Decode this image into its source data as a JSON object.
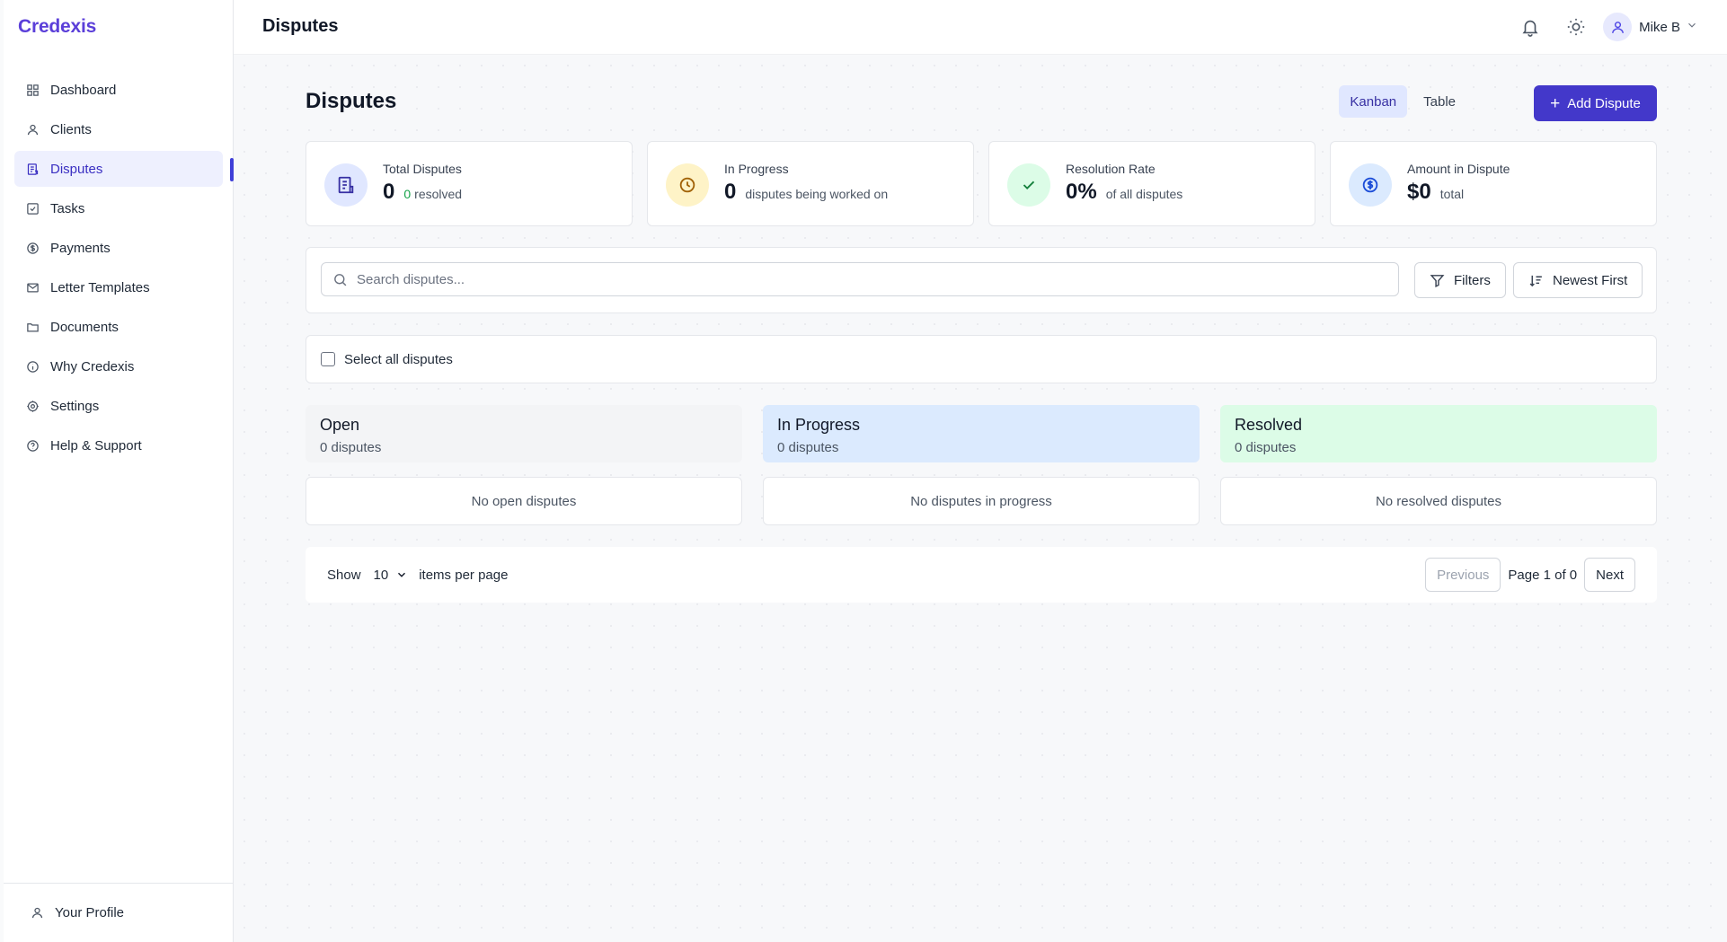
{
  "app": {
    "brand": "Credexis"
  },
  "header": {
    "title": "Disputes",
    "user_name": "Mike B"
  },
  "sidebar": {
    "items": [
      {
        "label": "Dashboard",
        "icon": "grid-icon"
      },
      {
        "label": "Clients",
        "icon": "user-icon"
      },
      {
        "label": "Disputes",
        "icon": "file-list-icon",
        "active": true
      },
      {
        "label": "Tasks",
        "icon": "checkbox-icon"
      },
      {
        "label": "Payments",
        "icon": "dollar-circle-icon"
      },
      {
        "label": "Letter Templates",
        "icon": "mail-icon"
      },
      {
        "label": "Documents",
        "icon": "folder-icon"
      },
      {
        "label": "Why Credexis",
        "icon": "info-icon"
      },
      {
        "label": "Settings",
        "icon": "gear-icon"
      },
      {
        "label": "Help & Support",
        "icon": "help-icon"
      }
    ],
    "profile_label": "Your Profile"
  },
  "page": {
    "title": "Disputes",
    "view_toggle": {
      "kanban": "Kanban",
      "table": "Table",
      "active": "Kanban"
    },
    "add_button": "Add Dispute"
  },
  "stats": [
    {
      "label": "Total Disputes",
      "value": "0",
      "sub_highlight": "0",
      "sub": "resolved",
      "icon": "document-icon",
      "color": "#e0e7ff"
    },
    {
      "label": "In Progress",
      "value": "0",
      "sub": "disputes being worked on",
      "icon": "clock-icon",
      "color": "#fef3c7"
    },
    {
      "label": "Resolution Rate",
      "value": "0%",
      "sub": "of all disputes",
      "icon": "check-icon",
      "color": "#dcfce7"
    },
    {
      "label": "Amount in Dispute",
      "value": "$0",
      "sub": "total",
      "icon": "dollar-circle-icon",
      "color": "#dbeafe"
    }
  ],
  "search": {
    "placeholder": "Search disputes...",
    "value": ""
  },
  "filters_label": "Filters",
  "sort_label": "Newest First",
  "select_all_label": "Select all disputes",
  "columns": [
    {
      "title": "Open",
      "count": "0 disputes",
      "empty": "No open disputes",
      "color": "#f3f4f6"
    },
    {
      "title": "In Progress",
      "count": "0 disputes",
      "empty": "No disputes in progress",
      "color": "#dbeafe"
    },
    {
      "title": "Resolved",
      "count": "0 disputes",
      "empty": "No resolved disputes",
      "color": "#dcfce7"
    }
  ],
  "pagination": {
    "show_label": "Show",
    "per_page": "10",
    "per_page_suffix": "items per page",
    "previous": "Previous",
    "page_text": "Page 1 of 0",
    "next": "Next"
  }
}
